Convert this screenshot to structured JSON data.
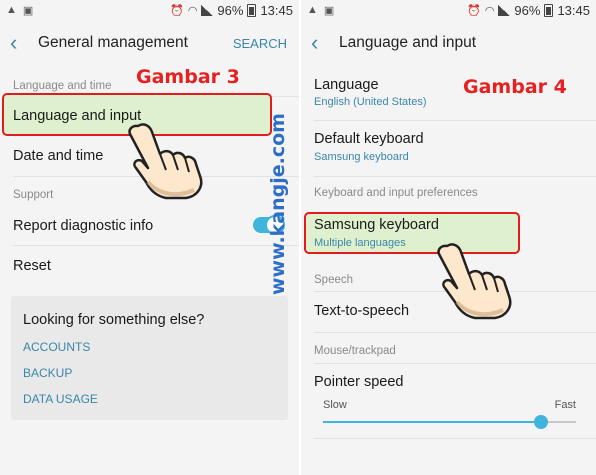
{
  "status": {
    "battery": "96%",
    "time": "13:45"
  },
  "left": {
    "title": "General management",
    "search": "SEARCH",
    "section_language": "Language and time",
    "item_language": "Language and input",
    "item_date": "Date and time",
    "section_support": "Support",
    "item_report": "Report diagnostic info",
    "report_toggle": "on",
    "item_reset": "Reset",
    "card": {
      "title": "Looking for something else?",
      "links": [
        "ACCOUNTS",
        "BACKUP",
        "DATA USAGE"
      ]
    },
    "annotation": "Gambar 3"
  },
  "right": {
    "title": "Language and input",
    "item_language": "Language",
    "item_language_sub": "English (United States)",
    "item_default_kb": "Default keyboard",
    "item_default_kb_sub": "Samsung keyboard",
    "section_kb": "Keyboard and input preferences",
    "item_samsung_kb": "Samsung keyboard",
    "item_samsung_kb_sub": "Multiple languages",
    "section_speech": "Speech",
    "item_tts": "Text-to-speech",
    "section_mouse": "Mouse/trackpad",
    "item_pointer": "Pointer speed",
    "slow": "Slow",
    "fast": "Fast",
    "pointer_speed_fraction": 0.86,
    "annotation": "Gambar 4"
  },
  "watermark": "www.kangje.com",
  "colors": {
    "accent": "#3a86a8",
    "highlight_border": "#e01c1c",
    "highlight_fill": "#dff0cf",
    "annotation": "#e52121"
  }
}
